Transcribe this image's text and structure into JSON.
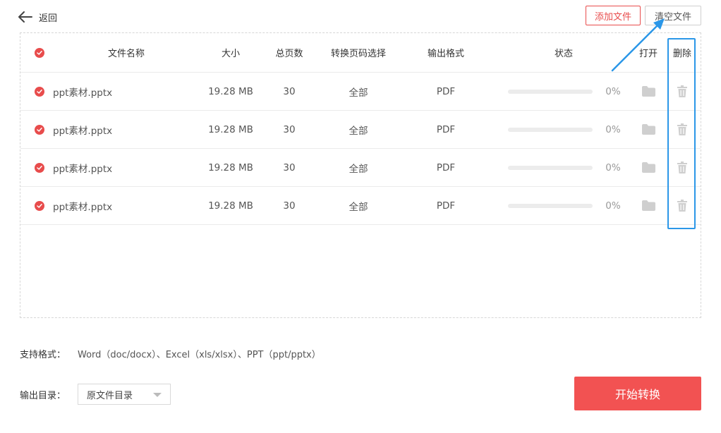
{
  "header": {
    "back_label": "返回",
    "add_file_label": "添加文件",
    "clear_files_label": "清空文件"
  },
  "table": {
    "columns": [
      "文件名称",
      "大小",
      "总页数",
      "转换页码选择",
      "输出格式",
      "状态",
      "打开",
      "删除"
    ],
    "rows": [
      {
        "name": "ppt素材.pptx",
        "size": "19.28 MB",
        "pages": "30",
        "range": "全部",
        "format": "PDF",
        "progress_text": "0%",
        "progress": 0
      },
      {
        "name": "ppt素材.pptx",
        "size": "19.28 MB",
        "pages": "30",
        "range": "全部",
        "format": "PDF",
        "progress_text": "0%",
        "progress": 0
      },
      {
        "name": "ppt素材.pptx",
        "size": "19.28 MB",
        "pages": "30",
        "range": "全部",
        "format": "PDF",
        "progress_text": "0%",
        "progress": 0
      },
      {
        "name": "ppt素材.pptx",
        "size": "19.28 MB",
        "pages": "30",
        "range": "全部",
        "format": "PDF",
        "progress_text": "0%",
        "progress": 0
      }
    ]
  },
  "footer": {
    "formats_label": "支持格式：",
    "formats_text": "Word（doc/docx）、Excel（xls/xlsx）、PPT（ppt/pptx）",
    "output_dir_label": "输出目录：",
    "output_dir_value": "原文件目录",
    "start_label": "开始转换"
  },
  "colors": {
    "accent_red": "#f25252",
    "annotation_blue": "#2b97e8",
    "icon_gray": "#cfcfcf"
  },
  "icons": {
    "back": "arrow-left-icon",
    "check": "check-circle-icon",
    "open": "folder-icon",
    "delete": "trash-icon",
    "dropdown": "caret-down-icon"
  }
}
